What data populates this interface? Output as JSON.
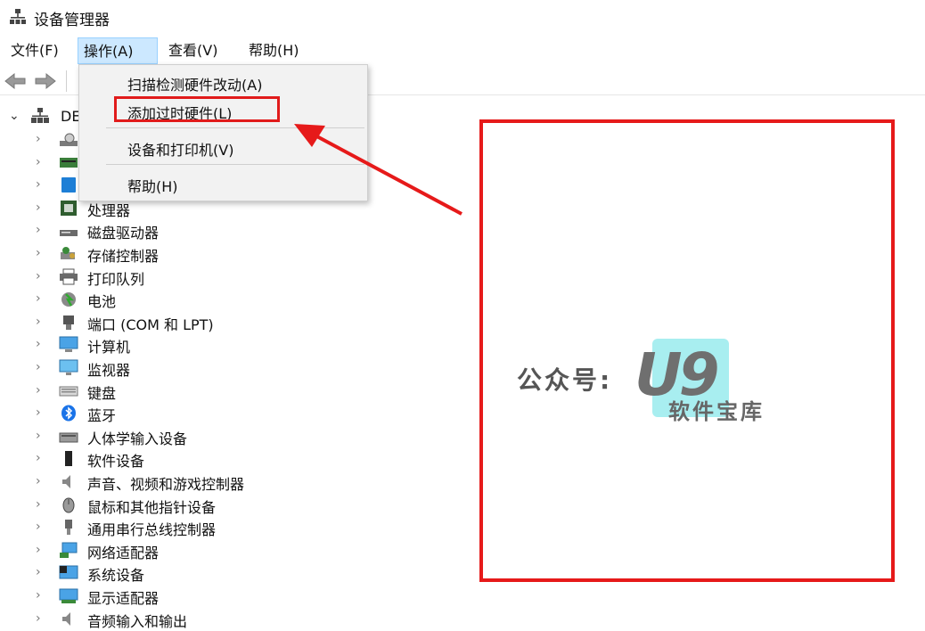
{
  "window": {
    "title": "设备管理器"
  },
  "menubar": {
    "file": "文件(F)",
    "action": "操作(A)",
    "view": "查看(V)",
    "help": "帮助(H)"
  },
  "dropdown": {
    "items": [
      "扫描检测硬件改动(A)",
      "添加过时硬件(L)",
      "设备和打印机(V)",
      "帮助(H)"
    ]
  },
  "tree": {
    "root_label": "DE",
    "nodes": [
      "",
      "",
      "",
      "处理器",
      "磁盘驱动器",
      "存储控制器",
      "打印队列",
      "电池",
      "端口 (COM 和 LPT)",
      "计算机",
      "监视器",
      "键盘",
      "蓝牙",
      "人体学输入设备",
      "软件设备",
      "声音、视频和游戏控制器",
      "鼠标和其他指针设备",
      "通用串行总线控制器",
      "网络适配器",
      "系统设备",
      "显示适配器",
      "音频输入和输出"
    ]
  },
  "watermark": {
    "prefix": "公众号:",
    "brand": "U9",
    "subtitle": "软件宝库"
  },
  "colors": {
    "highlight_red": "#e11b1b",
    "menu_active": "#cce8ff"
  }
}
